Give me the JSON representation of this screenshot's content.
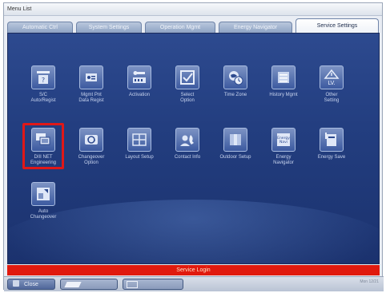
{
  "window": {
    "title": "Menu List"
  },
  "tabs": [
    {
      "label": "Automatic Ctrl",
      "active": false
    },
    {
      "label": "System Settings",
      "active": false
    },
    {
      "label": "Operation Mgmt",
      "active": false
    },
    {
      "label": "Energy Navigator",
      "active": false
    },
    {
      "label": "Service Settings",
      "active": true
    }
  ],
  "icons": [
    {
      "label": "S/C\nAuto/Regist",
      "icon": "sc-auto-regist-icon"
    },
    {
      "label": "Mgmt Pnt\nData Regist",
      "icon": "mgmt-point-data-icon"
    },
    {
      "label": "Activation",
      "icon": "activation-key-icon"
    },
    {
      "label": "Select\nOption",
      "icon": "select-option-checkbox-icon"
    },
    {
      "label": "Time Zone",
      "icon": "time-zone-globe-icon"
    },
    {
      "label": "History Mgmt",
      "icon": "history-mgmt-icon"
    },
    {
      "label": "Other\nSetting",
      "icon": "other-setting-warning-icon"
    },
    {
      "label": "DIII NET\nEngineering",
      "icon": "diii-net-engineering-icon",
      "highlighted": true
    },
    {
      "label": "Changeover\nOption",
      "icon": "changeover-option-icon"
    },
    {
      "label": "Layout Setup",
      "icon": "layout-setup-icon"
    },
    {
      "label": "Contact Info",
      "icon": "contact-info-icon"
    },
    {
      "label": "Outdoor Setup",
      "icon": "outdoor-setup-icon"
    },
    {
      "label": "Energy\nNavigator",
      "icon": "energy-navigator-icon"
    },
    {
      "label": "Energy Save",
      "icon": "energy-save-icon"
    },
    {
      "label": "Auto\nChangeover",
      "icon": "auto-changeover-icon"
    }
  ],
  "login_bar": {
    "label": "Service Login"
  },
  "bottom": {
    "close_label": "Close",
    "btn2_label": "",
    "btn3_label": "",
    "status_line1": "Mon 12/21",
    "status_line2": ""
  },
  "colors": {
    "panel_blue": "#233e80",
    "highlight_red": "#e01818",
    "login_red": "#e01a0e"
  }
}
